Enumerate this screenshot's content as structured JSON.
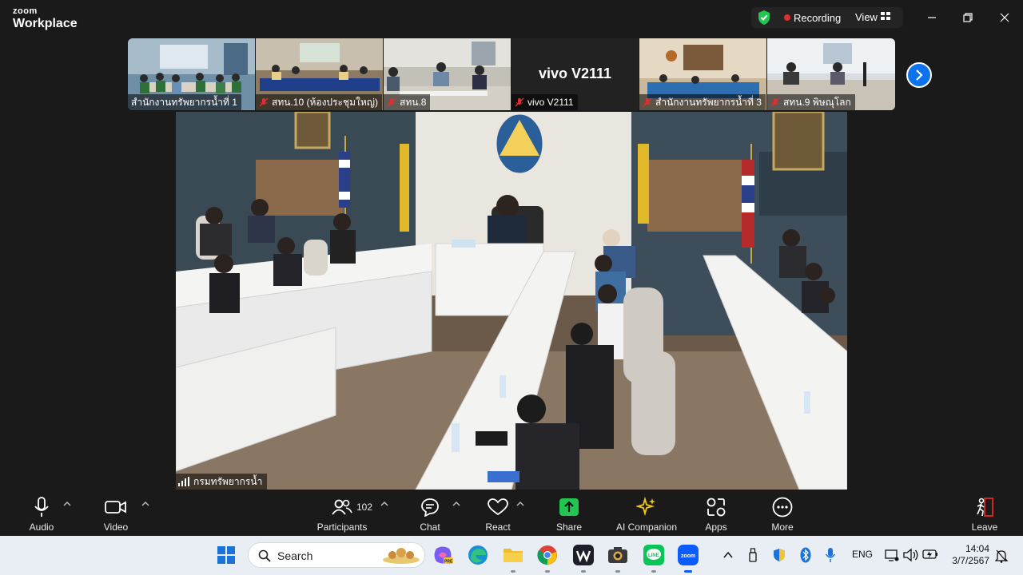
{
  "app": {
    "brand_line1": "zoom",
    "brand_line2": "Workplace",
    "recording_label": "Recording",
    "view_label": "View"
  },
  "gallery": {
    "tiles": [
      {
        "name": "สำนักงานทรัพยากรน้ำที่ 1",
        "muted": false
      },
      {
        "name": "สทน.10 (ห้องประชุมใหญ่)",
        "muted": true
      },
      {
        "name": "สทน.8",
        "muted": true
      },
      {
        "name": "vivo V2111",
        "muted": true,
        "video_off": true,
        "big_name": "vivo V2111"
      },
      {
        "name": "สำนักงานทรัพยากรน้ำที่ 3",
        "muted": true
      },
      {
        "name": "สทน.9 พิษณุโลก",
        "muted": true
      }
    ]
  },
  "main_video": {
    "name": "กรมทรัพยากรน้ำ"
  },
  "toolbar": {
    "audio": "Audio",
    "video": "Video",
    "participants": "Participants",
    "participants_count": "102",
    "chat": "Chat",
    "react": "React",
    "share": "Share",
    "ai_companion": "AI Companion",
    "apps": "Apps",
    "more": "More",
    "leave": "Leave"
  },
  "taskbar": {
    "search_placeholder": "Search",
    "language": "ENG",
    "time": "14:04",
    "date": "3/7/2567"
  },
  "colors": {
    "accent_blue": "#0e72ed",
    "recording_red": "#e02f2f",
    "share_green": "#23c552",
    "leave_red": "#e02828"
  }
}
